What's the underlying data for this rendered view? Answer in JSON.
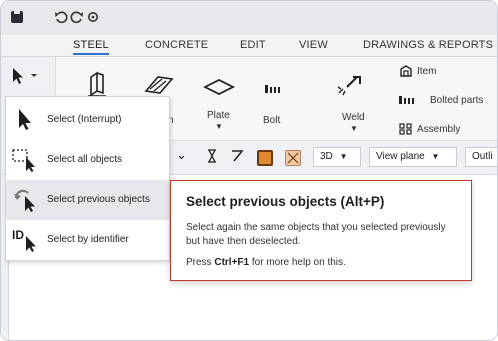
{
  "titlebar": {
    "undo_icon": "undo-icon",
    "redo_icon": "redo-icon",
    "settings_icon": "gear-icon"
  },
  "tabs": [
    {
      "label": "STEEL",
      "active": true
    },
    {
      "label": "CONCRETE",
      "active": false
    },
    {
      "label": "EDIT",
      "active": false
    },
    {
      "label": "VIEW",
      "active": false
    },
    {
      "label": "DRAWINGS & REPORTS",
      "active": false
    }
  ],
  "ribbon": {
    "plate_label": "Plate",
    "bolt_label": "Bolt",
    "weld_label": "Weld",
    "partial_label": "n",
    "item_label": "Item",
    "bolted_parts_label": "Bolted parts",
    "assembly_label": "Assembly"
  },
  "toolbar": {
    "view_3d_label": "3D",
    "view_plane_label": "View plane",
    "outline_label": "Outli"
  },
  "menu": {
    "items": [
      {
        "label": "Select (Interrupt)",
        "icon": "arrow-cursor-icon"
      },
      {
        "label": "Select all objects",
        "icon": "select-all-icon"
      },
      {
        "label": "Select previous objects",
        "icon": "select-previous-icon"
      },
      {
        "label": "Select by identifier",
        "icon": "select-id-icon"
      }
    ],
    "highlighted_index": 2,
    "id_glyph": "ID"
  },
  "tooltip": {
    "title": "Select previous objects (Alt+P)",
    "description": "Select again the same objects that you selected previously but have then deselected.",
    "hint_prefix": "Press ",
    "hint_key": "Ctrl+F1",
    "hint_suffix": " for more help on this."
  },
  "colors": {
    "accent": "#2a77c9",
    "tooltip_border": "#c0392b",
    "highlight_orange": "#e08a2e"
  }
}
